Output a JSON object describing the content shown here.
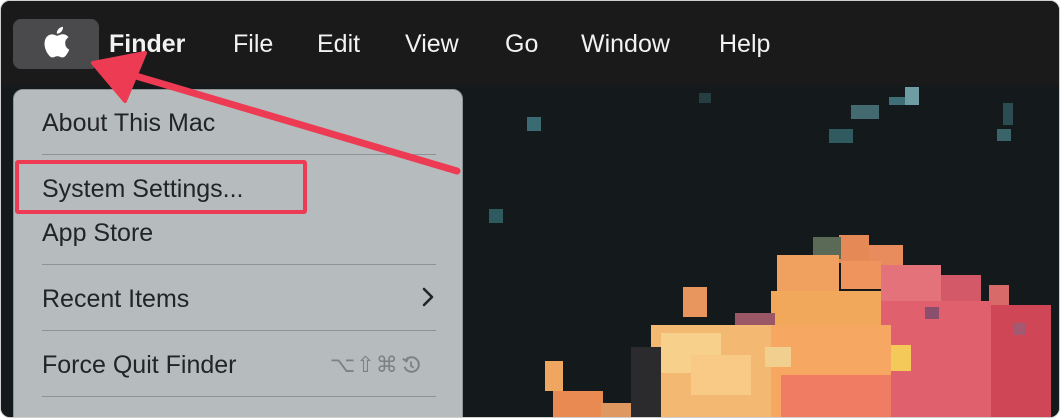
{
  "menubar": {
    "apple_icon": "apple-logo",
    "app_name": "Finder",
    "items": [
      "File",
      "Edit",
      "View",
      "Go",
      "Window",
      "Help"
    ]
  },
  "apple_menu": {
    "items": [
      {
        "label": "About This Mac"
      },
      {
        "label": "System Settings..."
      },
      {
        "label": "App Store"
      },
      {
        "label": "Recent Items",
        "submenu_icon": "chevron-right"
      },
      {
        "label": "Force Quit Finder",
        "shortcut": "⌥⇧⌘"
      }
    ],
    "shortcut_extra_icon": "undo-circle"
  },
  "annotations": {
    "highlight_color": "#ec3b52",
    "arrow_color": "#ec3b52"
  },
  "colors": {
    "menubar": "#1a1a1b",
    "menu_bg": "#b6bcbd",
    "wallpaper_bg": "#141a1c"
  }
}
